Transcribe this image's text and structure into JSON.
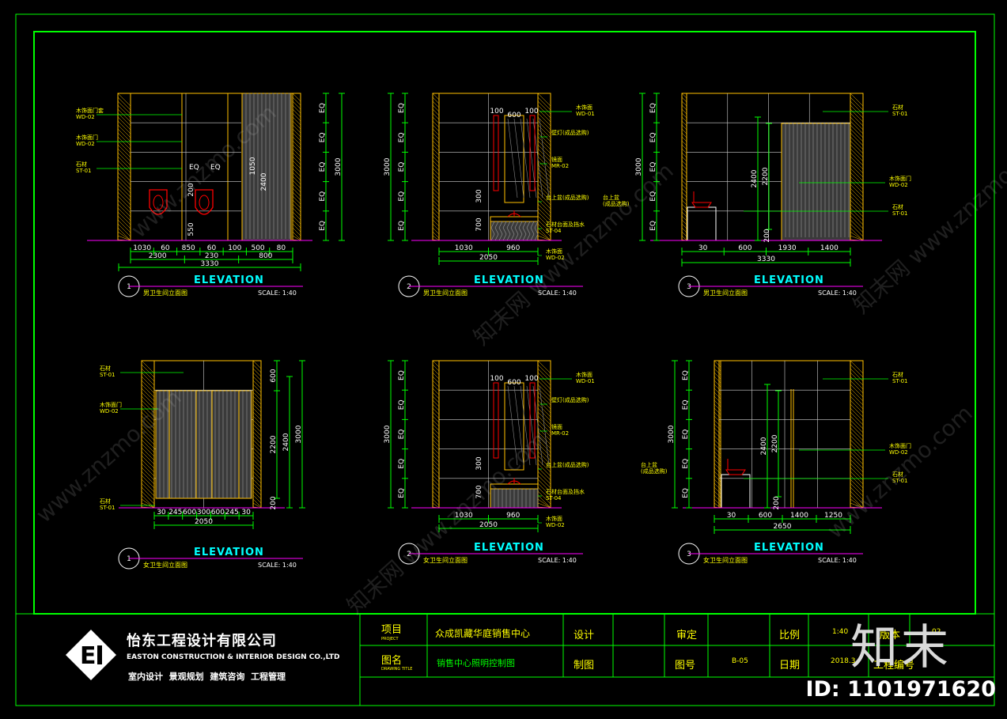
{
  "watermark": {
    "text_a": "www.znzmo.com",
    "text_b": "知末网 www.znzmo.com",
    "brand": "知末",
    "id": "ID: 1101971620"
  },
  "elevations": [
    {
      "num": "1",
      "heading": "ELEVATION",
      "subtitle": "男卫生间立面图",
      "scale": "SCALE: 1:40",
      "labels": [
        "木饰面门套",
        "WD-02",
        "木饰面门",
        "WD-02",
        "石材",
        "ST-01"
      ],
      "dims_bottom": [
        "1030",
        "60",
        "850",
        "60",
        "100",
        "500",
        "80",
        "2300",
        "230",
        "800",
        "3330"
      ],
      "dims_right": [
        "EQ",
        "EQ",
        "EQ",
        "EQ",
        "EQ",
        "3000"
      ],
      "dims_inner": [
        "EQ",
        "EQ",
        "200",
        "550",
        "1050",
        "2400"
      ]
    },
    {
      "num": "2",
      "heading": "ELEVATION",
      "subtitle": "男卫生间立面图",
      "scale": "SCALE: 1:40",
      "labels": [
        "木饰面",
        "WD-01",
        "壁灯(成品选购)",
        "镜面",
        "MR-02",
        "台上盆(成品选购)",
        "石材台面及挡水",
        "ST-04",
        "木饰面",
        "WD-02"
      ],
      "dims_bottom": [
        "1030",
        "960",
        "2050"
      ],
      "dims_left": [
        "EQ",
        "EQ",
        "EQ",
        "EQ",
        "EQ",
        "3000"
      ],
      "dims_inner": [
        "100",
        "600",
        "100",
        "300",
        "700"
      ]
    },
    {
      "num": "3",
      "heading": "ELEVATION",
      "subtitle": "男卫生间立面图",
      "scale": "SCALE: 1:40",
      "labels": [
        "石材",
        "ST-01",
        "木饰面门",
        "WD-02",
        "石材",
        "ST-01",
        "台上盆",
        "(成品选购)"
      ],
      "dims_bottom": [
        "30",
        "600",
        "1930",
        "1400",
        "3330"
      ],
      "dims_left": [
        "EQ",
        "EQ",
        "EQ",
        "EQ",
        "EQ",
        "3000"
      ],
      "dims_inner": [
        "2400",
        "2200",
        "200"
      ]
    },
    {
      "num": "1",
      "heading": "ELEVATION",
      "subtitle": "女卫生间立面图",
      "scale": "SCALE: 1:40",
      "labels": [
        "石材",
        "ST-01",
        "木饰面门",
        "WD-02",
        "石材",
        "ST-01"
      ],
      "dims_bottom": [
        "30",
        "245",
        "600",
        "300",
        "600",
        "245",
        "30",
        "2050"
      ],
      "dims_right": [
        "600",
        "2200",
        "2400",
        "3000",
        "200"
      ]
    },
    {
      "num": "2",
      "heading": "ELEVATION",
      "subtitle": "女卫生间立面图",
      "scale": "SCALE: 1:40",
      "labels": [
        "木饰面",
        "WD-01",
        "壁灯(成品选购)",
        "镜面",
        "MR-02",
        "台上盆(成品选购)",
        "石材台面及挡水",
        "ST-04",
        "木饰面",
        "WD-02"
      ],
      "dims_bottom": [
        "1030",
        "960",
        "2050"
      ],
      "dims_left": [
        "EQ",
        "EQ",
        "EQ",
        "EQ",
        "EQ",
        "3000"
      ],
      "dims_inner": [
        "100",
        "600",
        "100",
        "300",
        "700"
      ]
    },
    {
      "num": "3",
      "heading": "ELEVATION",
      "subtitle": "女卫生间立面图",
      "scale": "SCALE: 1:40",
      "labels": [
        "石材",
        "ST-01",
        "木饰面门",
        "WD-02",
        "石材",
        "ST-01",
        "台上盆",
        "(成品选购)"
      ],
      "dims_bottom": [
        "30",
        "600",
        "1400",
        "1250",
        "2650"
      ],
      "dims_left": [
        "EQ",
        "EQ",
        "EQ",
        "EQ",
        "EQ",
        "3000"
      ],
      "dims_inner": [
        "2400",
        "2200",
        "200"
      ]
    }
  ],
  "title_block": {
    "company_cn": "怡东工程设计有限公司",
    "company_en": "EASTON CONSTRUCTION & INTERIOR DESIGN CO.,LTD",
    "services": "室内设计  景观规划  建筑咨询  工程管理",
    "project_label": "项目",
    "project_label_en": "PROJECT",
    "project_value": "众成凯藏华庭销售中心",
    "drawing_label": "图名",
    "drawing_label_en": "DRAWING TITLE",
    "drawing_value": "销售中心照明控制图",
    "design_label": "设计",
    "draw_label": "制图",
    "check_label": "审定",
    "sheet_label": "图号",
    "sheet_value": "B-05",
    "scale_label": "比例",
    "scale_value": "1:40",
    "date_label": "日期",
    "date_value": "2018.3",
    "version_label": "版本",
    "version_value": "02",
    "job_label": "工程编号"
  },
  "colors": {
    "frame": "#00ff00",
    "wall": "#ffc000",
    "grid": "#ffffff",
    "dim": "#00ff00",
    "accent": "#ff00ff",
    "fixture": "#ff0000",
    "title": "#00ffff",
    "label": "#ffff00"
  }
}
